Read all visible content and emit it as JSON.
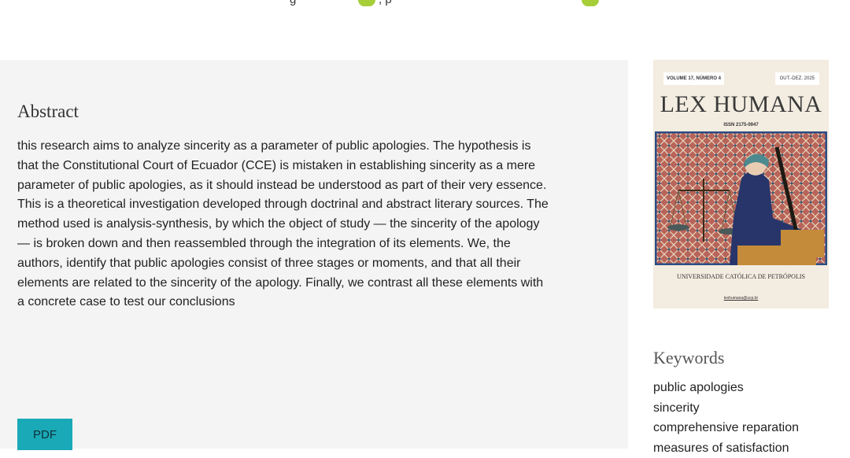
{
  "abstract": {
    "title": "Abstract",
    "text": "this research aims to analyze sincerity as a parameter of public apologies. The hypothesis is that the Constitutional Court of Ecuador (CCE) is mistaken in establishing sincerity as a mere parameter of public apologies, as it should instead be understood as part of their very essence. This is a theoretical investigation developed through doctrinal and abstract literary sources. The method used is analysis-synthesis, by which the object of study — the sincerity of the apology — is broken down and then reassembled through the integration of its elements. We, the authors, identify that public apologies consist of three stages or moments, and that all their elements are related to the sincerity of the apology. Finally, we contrast all these elements with a concrete case to test our conclusions"
  },
  "pdf_label": "PDF",
  "cover": {
    "volume": "VOLUME 17, NÚMERO 4",
    "date": "OUT.-DEZ. 2025",
    "journal": "LEX HUMANA",
    "issn": "ISSN 2175-0947",
    "university": "UNIVERSIDADE CATÓLICA DE PETRÓPOLIS",
    "email": "lexhumana@ucp.br"
  },
  "keywords": {
    "title": "Keywords",
    "items": [
      "public apologies",
      "sincerity",
      "comprehensive reparation",
      "measures of satisfaction"
    ]
  },
  "colors": {
    "panel_bg": "#f4f4f4",
    "pdf_button": "#1aa9b7",
    "orcid_green": "#a6ce39",
    "cover_bg": "#f3ece0"
  },
  "icons": [
    "orcid-icon"
  ]
}
